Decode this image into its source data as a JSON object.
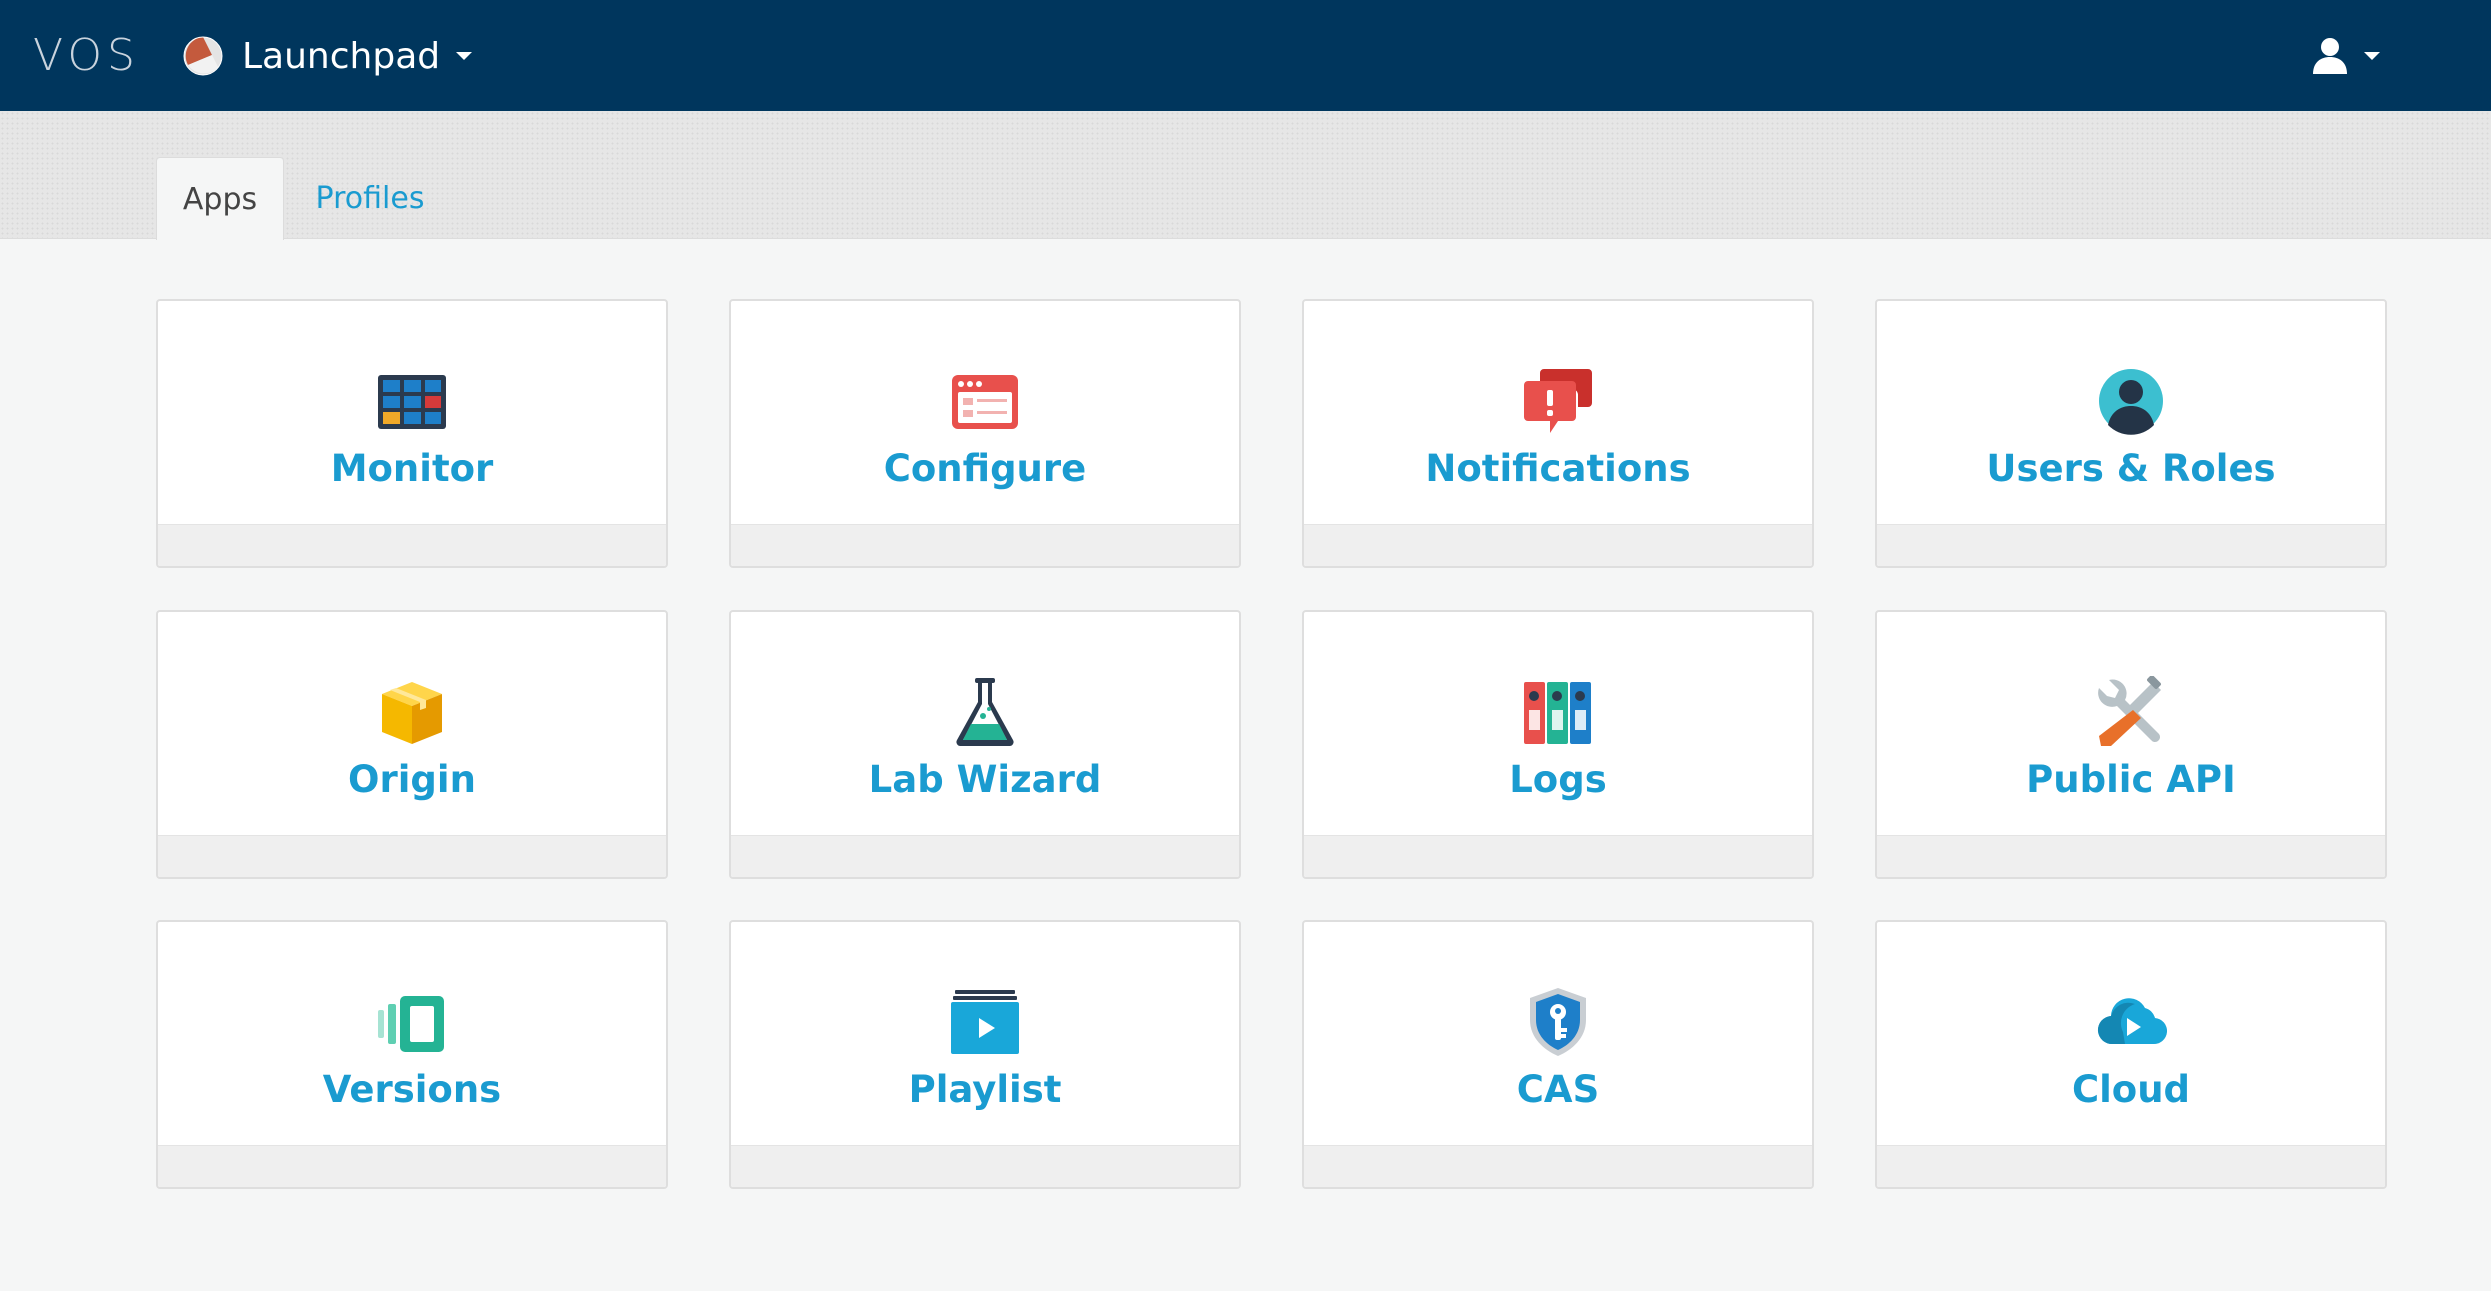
{
  "header": {
    "brand": "VOS",
    "app_name": "Launchpad",
    "app_logo_icon": "launchpad-logo-icon",
    "user_icon": "user-icon"
  },
  "tabs": [
    {
      "label": "Apps",
      "active": true
    },
    {
      "label": "Profiles",
      "active": false
    }
  ],
  "tiles": [
    {
      "label": "Monitor",
      "icon": "monitor-grid-icon"
    },
    {
      "label": "Configure",
      "icon": "configure-window-icon"
    },
    {
      "label": "Notifications",
      "icon": "notifications-bubble-icon"
    },
    {
      "label": "Users & Roles",
      "icon": "user-avatar-icon"
    },
    {
      "label": "Origin",
      "icon": "package-box-icon"
    },
    {
      "label": "Lab Wizard",
      "icon": "lab-flask-icon"
    },
    {
      "label": "Logs",
      "icon": "binders-icon"
    },
    {
      "label": "Public API",
      "icon": "tools-icon"
    },
    {
      "label": "Versions",
      "icon": "versions-icon"
    },
    {
      "label": "Playlist",
      "icon": "playlist-icon"
    },
    {
      "label": "CAS",
      "icon": "shield-key-icon"
    },
    {
      "label": "Cloud",
      "icon": "cloud-play-icon"
    }
  ],
  "colors": {
    "header_bg": "#00365d",
    "accent": "#1a9bd0",
    "page_bg": "#f5f6f6"
  }
}
